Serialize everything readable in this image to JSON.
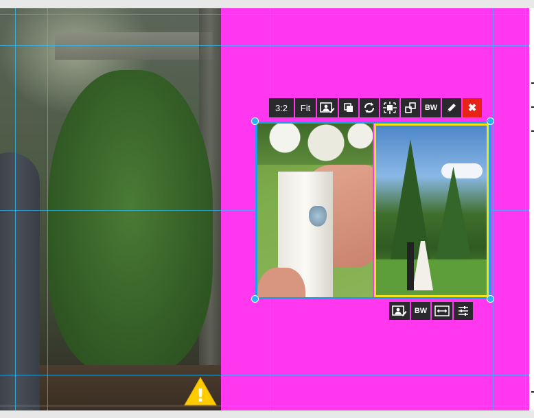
{
  "app": {
    "accent_color": "#1da1e6",
    "page_background_color": "#ff37ee",
    "selected_photo_border_color": "#f5e21a"
  },
  "canvas": {
    "left_photo": {
      "icon": "groom-garden-photo"
    },
    "page": {
      "background": "#ff37ee"
    }
  },
  "top_toolbar": {
    "aspect_ratio_label": "3:2",
    "fit_label": "Fit",
    "replace_icon": "replace-photo-icon",
    "duplicate_icon": "duplicate-icon",
    "swap_icon": "swap-icon",
    "center_icon": "center-icon",
    "resize_icon": "resize-icon",
    "bw_label": "BW",
    "edit_icon": "pencil-icon",
    "close_label": "✖",
    "close_color": "#e8241a"
  },
  "selection": {
    "photos": [
      {
        "name": "bouquet-photo",
        "icon": "bouquet-with-charm-image"
      },
      {
        "name": "wedding-couple-photo",
        "icon": "couple-kissing-in-park-image"
      }
    ]
  },
  "bottom_toolbar": {
    "replace_icon": "replace-photo-icon",
    "bw_label": "BW",
    "expand_icon": "expand-horizontal-icon",
    "adjust_icon": "sliders-icon"
  },
  "warning": {
    "icon": "warning-triangle-icon",
    "symbol": "!",
    "color": "#ffcc00"
  }
}
